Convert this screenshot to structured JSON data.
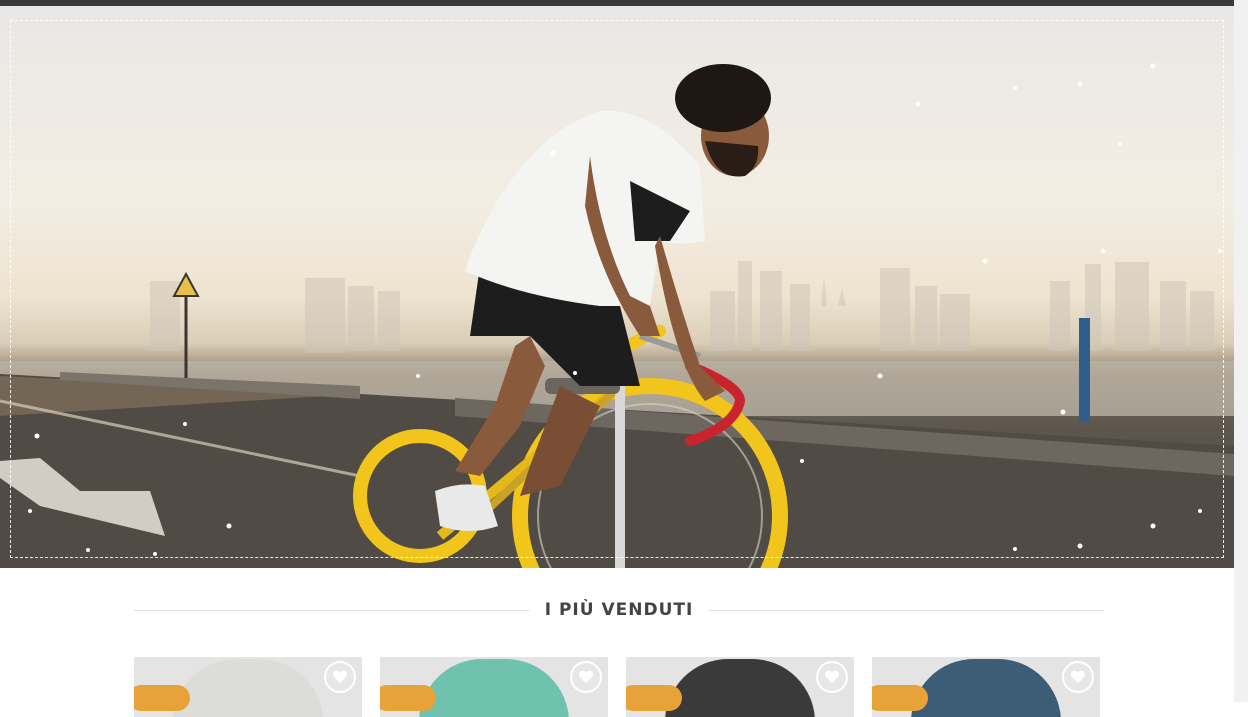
{
  "section": {
    "title": "I PIÙ VENDUTI"
  },
  "hero": {
    "image": "cyclist-on-yellow-fixie-city-skyline"
  },
  "products": [
    {
      "name": "product-card-white-helmet",
      "helmet_color": "#dcdcd8",
      "badge": "",
      "wishlist_icon": "heart-icon"
    },
    {
      "name": "product-card-teal-helmet",
      "helmet_color": "#6fc3ae",
      "badge": "",
      "wishlist_icon": "heart-icon"
    },
    {
      "name": "product-card-black-helmet",
      "helmet_color": "#3a3a3a",
      "badge": "",
      "wishlist_icon": "heart-icon"
    },
    {
      "name": "product-card-blue-helmet",
      "helmet_color": "#3c5d75",
      "badge": "",
      "wishlist_icon": "heart-icon"
    }
  ],
  "colors": {
    "badge": "#e8a23a",
    "title_text": "#444444",
    "bike_yellow": "#f2c51c",
    "handlebar_red": "#c9232e"
  }
}
